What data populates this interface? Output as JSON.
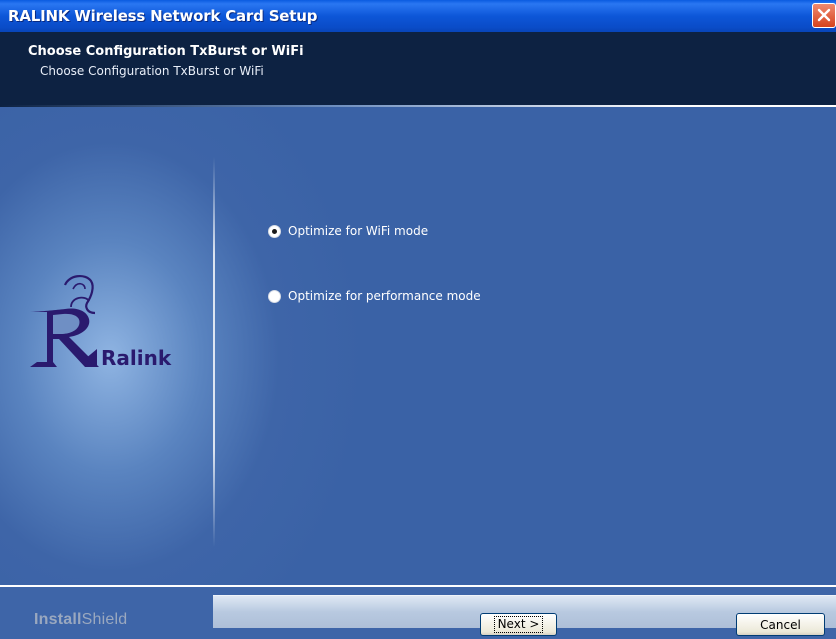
{
  "window": {
    "title": "RALINK Wireless Network Card Setup",
    "close_icon": "close-icon"
  },
  "header": {
    "title": "Choose Configuration TxBurst or WiFi",
    "subtitle": "Choose Configuration TxBurst or WiFi"
  },
  "sidebar": {
    "logo_text": "Ralink",
    "logo_icon": "ralink-logo-icon"
  },
  "options": [
    {
      "label": "Optimize for WiFi mode",
      "selected": true
    },
    {
      "label": "Optimize for performance mode",
      "selected": false
    }
  ],
  "footer": {
    "brand_bold": "Install",
    "brand_thin": "Shield",
    "next_label": "Next >",
    "cancel_label": "Cancel"
  },
  "colors": {
    "titlebar": "#0a4cc8",
    "header_bg": "#0d2242",
    "main_bg": "#3e65a8",
    "logo_purple": "#2a1a6e"
  }
}
